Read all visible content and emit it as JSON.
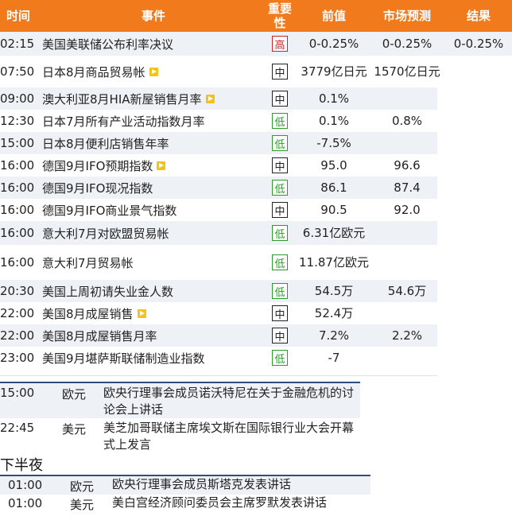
{
  "header": {
    "time": "时间",
    "event": "事件",
    "importance": "重要性",
    "previous": "前值",
    "forecast": "市场预测",
    "actual": "结果"
  },
  "rows": [
    {
      "time": "02:15",
      "event": "美国美联储公布利率决议",
      "video": false,
      "importance": "高",
      "level": "high",
      "previous": "0-0.25%",
      "forecast": "0-0.25%",
      "actual": "0-0.25%"
    },
    {
      "time": "07:50",
      "event": "日本8月商品贸易帐",
      "video": true,
      "importance": "中",
      "level": "medium",
      "previous": "3779亿日元",
      "forecast": "1570亿日元",
      "actual": ""
    },
    {
      "time": "09:00",
      "event": "澳大利亚8月HIA新屋销售月率",
      "video": true,
      "importance": "中",
      "level": "medium",
      "previous": "0.1%",
      "forecast": "",
      "actual": ""
    },
    {
      "time": "12:30",
      "event": "日本7月所有产业活动指数月率",
      "video": false,
      "importance": "低",
      "level": "low",
      "previous": "0.1%",
      "forecast": "0.8%",
      "actual": ""
    },
    {
      "time": "15:00",
      "event": "日本8月便利店销售年率",
      "video": false,
      "importance": "低",
      "level": "low",
      "previous": "-7.5%",
      "forecast": "",
      "actual": ""
    },
    {
      "time": "16:00",
      "event": "德国9月IFO预期指数",
      "video": true,
      "importance": "中",
      "level": "medium",
      "previous": "95.0",
      "forecast": "96.6",
      "actual": ""
    },
    {
      "time": "16:00",
      "event": "德国9月IFO现况指数",
      "video": false,
      "importance": "低",
      "level": "low",
      "previous": "86.1",
      "forecast": "87.4",
      "actual": ""
    },
    {
      "time": "16:00",
      "event": "德国9月IFO商业景气指数",
      "video": false,
      "importance": "中",
      "level": "medium",
      "previous": "90.5",
      "forecast": "92.0",
      "actual": ""
    },
    {
      "time": "16:00",
      "event": "意大利7月对欧盟贸易帐",
      "video": false,
      "importance": "低",
      "level": "low",
      "previous": "6.31亿欧元",
      "forecast": "",
      "actual": ""
    },
    {
      "time": "16:00",
      "event": "意大利7月贸易帐",
      "video": false,
      "importance": "低",
      "level": "low",
      "previous": "11.87亿欧元",
      "forecast": "",
      "actual": ""
    },
    {
      "time": "20:30",
      "event": "美国上周初请失业金人数",
      "video": false,
      "importance": "低",
      "level": "low",
      "previous": "54.5万",
      "forecast": "54.6万",
      "actual": ""
    },
    {
      "time": "22:00",
      "event": "美国8月成屋销售",
      "video": true,
      "importance": "中",
      "level": "medium",
      "previous": "52.4万",
      "forecast": "",
      "actual": ""
    },
    {
      "time": "22:00",
      "event": "美国8月成屋销售月率",
      "video": false,
      "importance": "中",
      "level": "medium",
      "previous": "7.2%",
      "forecast": "2.2%",
      "actual": ""
    },
    {
      "time": "23:00",
      "event": "美国9月堪萨斯联储制造业指数",
      "video": false,
      "importance": "低",
      "level": "low",
      "previous": "-7",
      "forecast": "",
      "actual": ""
    }
  ],
  "speeches": [
    {
      "time": "15:00",
      "currency": "欧元",
      "event": "欧央行理事会成员诺沃特尼在关于金融危机的讨论会上讲话"
    },
    {
      "time": "22:45",
      "currency": "美元",
      "event": "美芝加哥联储主席埃文斯在国际银行业大会开幕式上发言"
    }
  ],
  "second_half": {
    "title": "下半夜",
    "items": [
      {
        "time": "01:00",
        "currency": "欧元",
        "event": "欧央行理事会成员斯塔克发表讲话"
      },
      {
        "time": "01:00",
        "currency": "美元",
        "event": "美白宫经济顾问委员会主席罗默发表讲话"
      }
    ]
  },
  "colors": {
    "header_bg": "#f07a1c",
    "row_alt_bg": "#eef1f5",
    "high": "#cc2222",
    "medium": "#ee7a10",
    "low": "#2e9a2e",
    "divider": "#2c4e7a"
  }
}
